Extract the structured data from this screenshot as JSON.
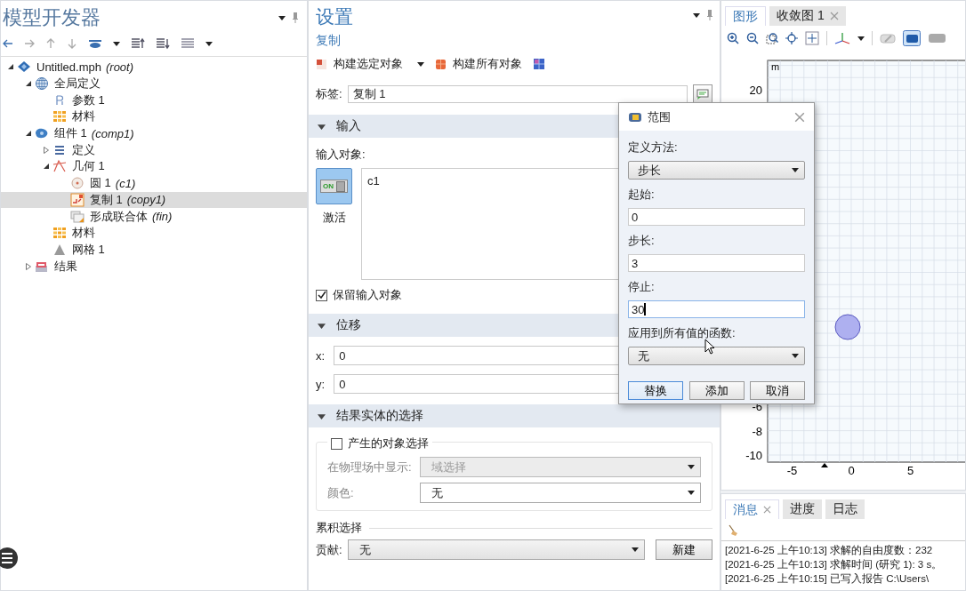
{
  "model_builder": {
    "title": "模型开发器",
    "tree": [
      {
        "label": "Untitled.mph",
        "tag": "(root)",
        "kind": "file",
        "expanded": true,
        "selected": false,
        "children": [
          {
            "label": "全局定义",
            "kind": "globe",
            "expanded": true,
            "selected": false,
            "children": [
              {
                "label": "参数 1",
                "kind": "param",
                "selected": false
              },
              {
                "label": "材料",
                "kind": "material",
                "selected": false
              }
            ]
          },
          {
            "label": "组件 1",
            "tag": "(comp1)",
            "kind": "component",
            "expanded": true,
            "selected": false,
            "children": [
              {
                "label": "定义",
                "kind": "list",
                "expanded": false,
                "selected": false
              },
              {
                "label": "几何 1",
                "kind": "geometry",
                "expanded": true,
                "selected": false,
                "children": [
                  {
                    "label": "圆 1",
                    "tag": "(c1)",
                    "kind": "circle",
                    "selected": false
                  },
                  {
                    "label": "复制 1",
                    "tag": "(copy1)",
                    "kind": "copy",
                    "selected": true
                  },
                  {
                    "label": "形成联合体",
                    "tag": "(fin)",
                    "kind": "union",
                    "selected": false
                  }
                ]
              },
              {
                "label": "材料",
                "kind": "material",
                "selected": false
              },
              {
                "label": "网格 1",
                "kind": "mesh",
                "selected": false
              }
            ]
          },
          {
            "label": "结果",
            "kind": "results",
            "expanded": false,
            "selected": false
          }
        ]
      }
    ]
  },
  "settings": {
    "title": "设置",
    "subtitle": "复制",
    "toolbar": [
      {
        "kind": "build-selected",
        "label": "构建选定对象",
        "dropdown": true
      },
      {
        "kind": "build-all",
        "label": "构建所有对象",
        "dropdown": false
      },
      {
        "kind": "graphics",
        "dropdown": false
      }
    ],
    "label_field": {
      "label": "标签:",
      "value": "复制 1"
    },
    "input_section": {
      "title": "输入",
      "expanded": true,
      "objects_label": "输入对象:",
      "activate": {
        "on_text": "ON",
        "label": "激活",
        "on": true
      },
      "objects": [
        "c1"
      ],
      "keep": {
        "label": "保留输入对象",
        "checked": true
      }
    },
    "displacement_section": {
      "title": "位移",
      "expanded": true,
      "fields": [
        {
          "label": "x:",
          "value": "0"
        },
        {
          "label": "y:",
          "value": "0"
        }
      ]
    },
    "selection_section": {
      "title": "结果实体的选择",
      "expanded": true,
      "checkbox": {
        "label": "产生的对象选择",
        "checked": false
      },
      "rows": [
        {
          "label": "在物理场中显示:",
          "value": "域选择",
          "disabled": true
        },
        {
          "label": "颜色:",
          "value": "无",
          "disabled": false
        }
      ],
      "cumulative": {
        "title": "累积选择",
        "label": "贡献:",
        "value": "无",
        "button": "新建"
      }
    }
  },
  "graphics": {
    "tabs": [
      {
        "label": "图形",
        "selected": true,
        "closable": false
      },
      {
        "label": "收敛图 1",
        "selected": false,
        "closable": true
      }
    ],
    "unit": "m",
    "y_labels": [
      "20",
      "-6",
      "-8",
      "-10"
    ],
    "x_labels": [
      "-5",
      "0",
      "5"
    ]
  },
  "messages": {
    "tabs": [
      {
        "label": "消息",
        "selected": true,
        "closable": true
      },
      {
        "label": "进度",
        "selected": false,
        "closable": false
      },
      {
        "label": "日志",
        "selected": false,
        "closable": false
      }
    ],
    "lines": [
      "[2021-6-25 上午10:13] 求解的自由度数：232",
      "[2021-6-25 上午10:13] 求解时间 (研究 1): 3 s。",
      "[2021-6-25 上午10:15] 已写入报告 C:\\Users\\"
    ]
  },
  "dialog": {
    "title": "范围",
    "fields": [
      {
        "kind": "select",
        "label": "定义方法:",
        "value": "步长",
        "focused": false
      },
      {
        "kind": "input",
        "label": "起始:",
        "value": "0",
        "focused": false
      },
      {
        "kind": "input",
        "label": "步长:",
        "value": "3",
        "focused": false
      },
      {
        "kind": "input",
        "label": "停止:",
        "value": "30",
        "focused": true
      },
      {
        "kind": "select",
        "label": "应用到所有值的函数:",
        "value": "无",
        "focused": false
      }
    ],
    "buttons": [
      {
        "label": "替换",
        "default": true
      },
      {
        "label": "添加",
        "default": false
      },
      {
        "label": "取消",
        "default": false
      }
    ]
  }
}
